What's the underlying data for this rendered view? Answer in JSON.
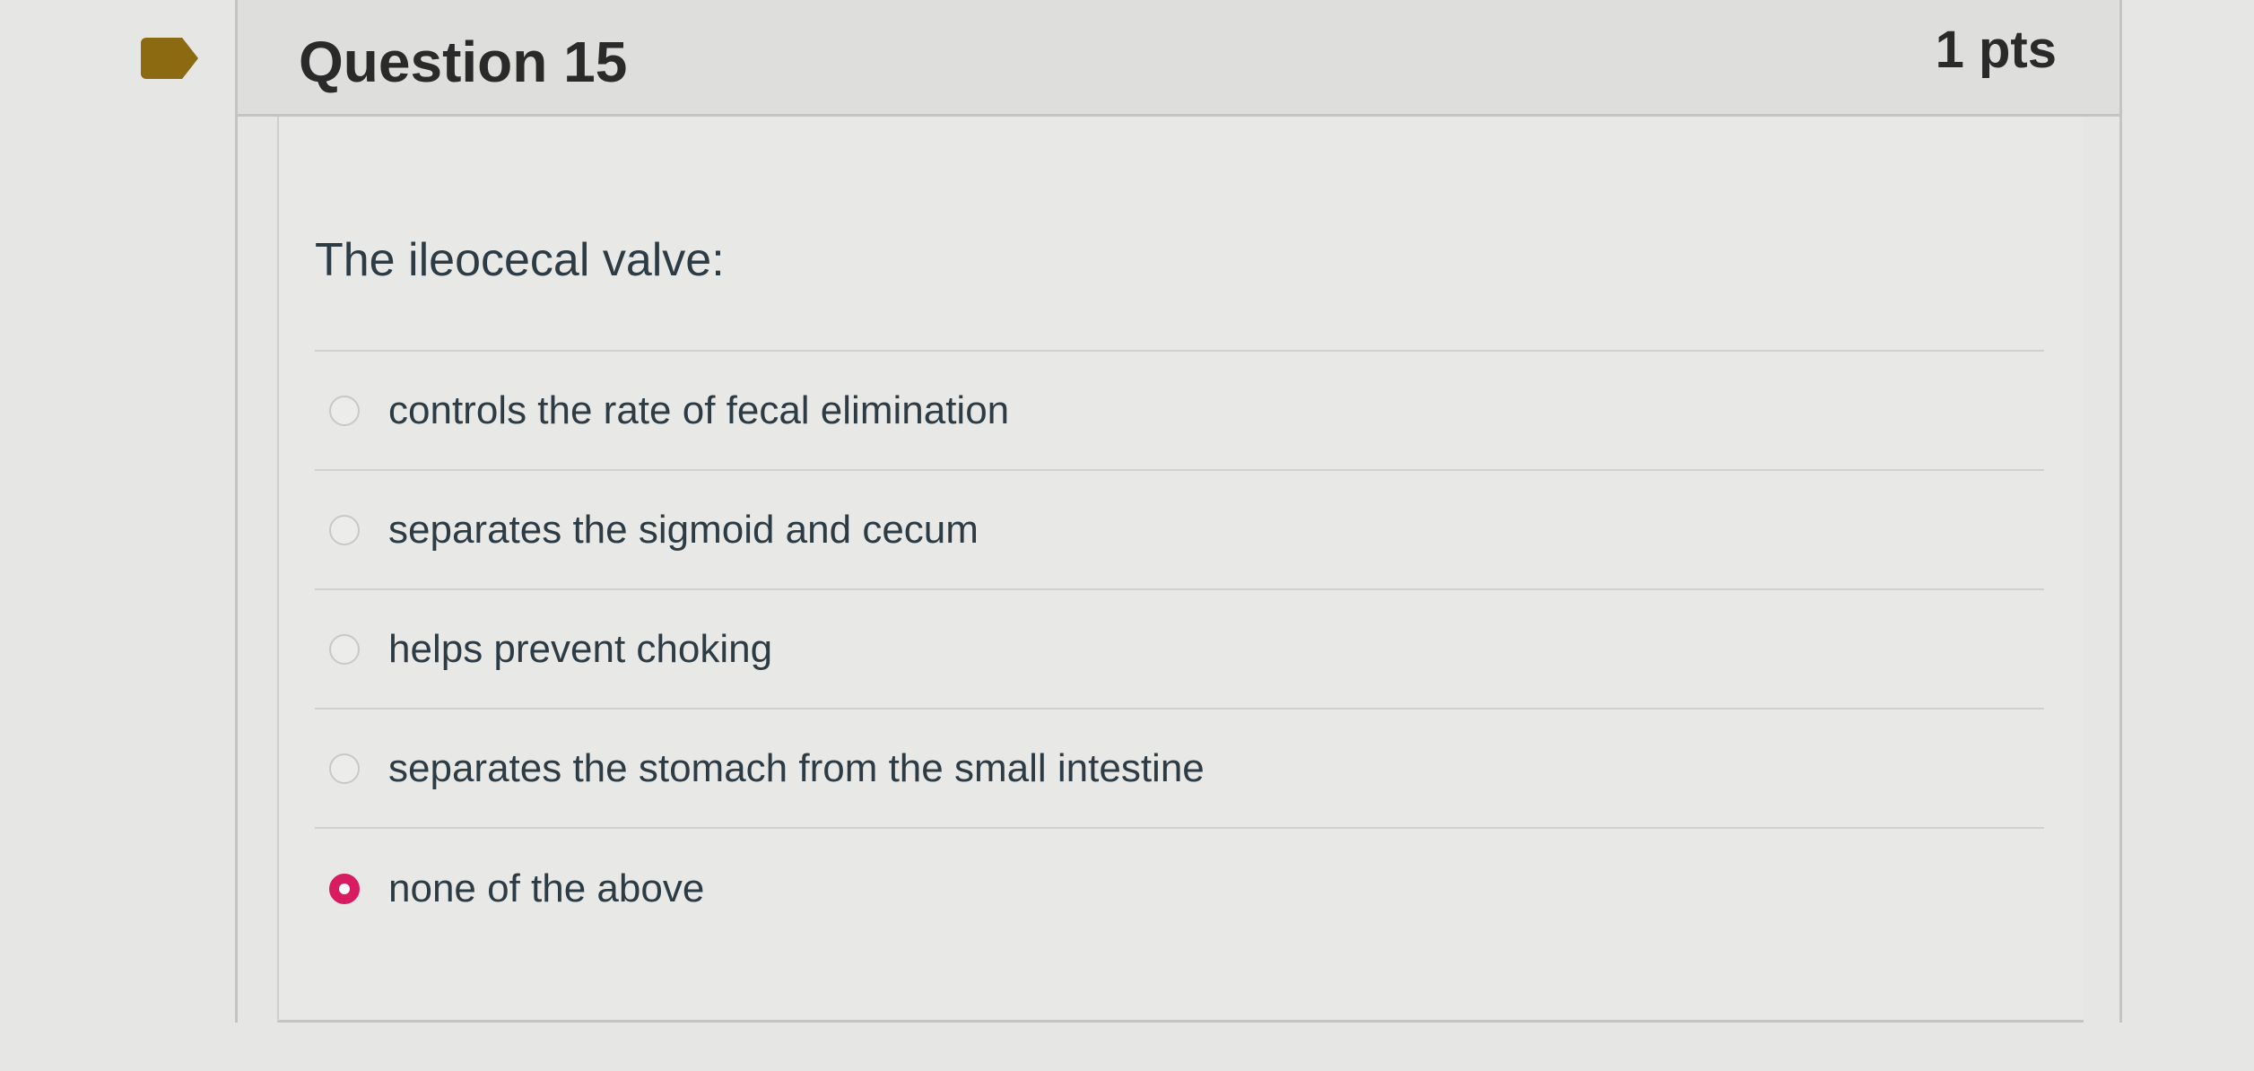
{
  "question": {
    "title": "Question 15",
    "points": "1 pts",
    "text": "The ileocecal valve:",
    "answers": [
      {
        "label": "controls the rate of fecal elimination",
        "selected": false
      },
      {
        "label": "separates the sigmoid and cecum",
        "selected": false
      },
      {
        "label": "helps prevent choking",
        "selected": false
      },
      {
        "label": "separates the stomach from the small intestine",
        "selected": false
      },
      {
        "label": "none of the above",
        "selected": true
      }
    ]
  },
  "colors": {
    "flag": "#8c6a12",
    "selected_radio": "#d91b62",
    "text": "#2d3b45",
    "background": "#e6e6e4"
  }
}
